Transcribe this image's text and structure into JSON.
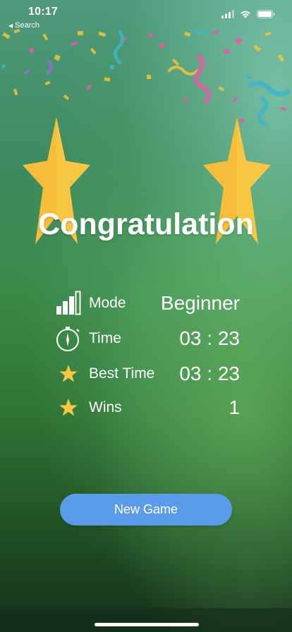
{
  "status_bar": {
    "time": "10:17",
    "back_label": "Search"
  },
  "title": "Congratulation",
  "stats": [
    {
      "label": "Mode",
      "value": "Beginner",
      "icon": "signal-bars-icon"
    },
    {
      "label": "Time",
      "value": "03 : 23",
      "icon": "stopwatch-icon"
    },
    {
      "label": "Best Time",
      "value": "03 : 23",
      "icon": "star-icon"
    },
    {
      "label": "Wins",
      "value": "1",
      "icon": "star-icon"
    }
  ],
  "new_game_label": "New Game",
  "colors": {
    "button": "#5a9bea",
    "star": "#f8c642",
    "background": "#3b8a4a"
  }
}
